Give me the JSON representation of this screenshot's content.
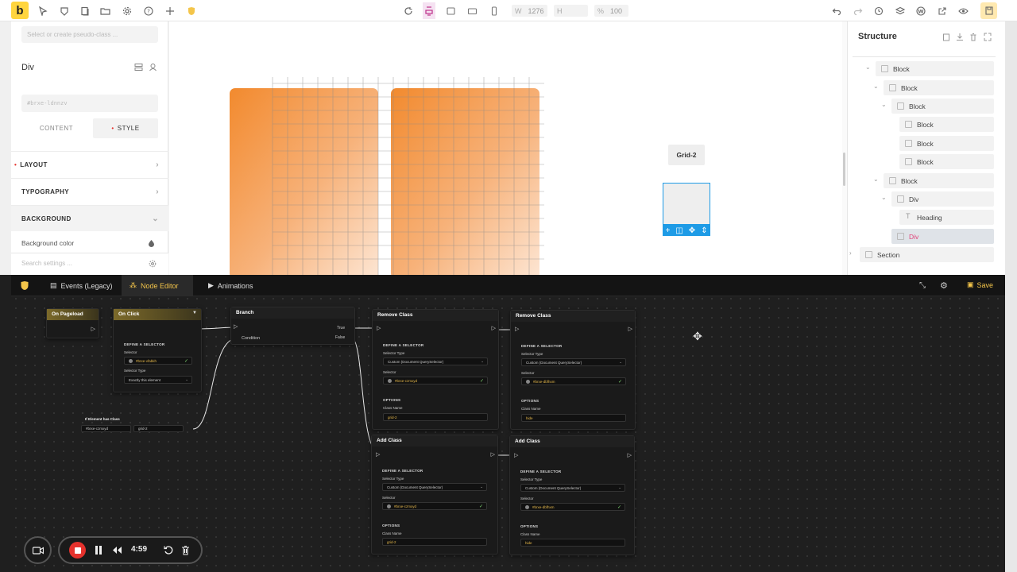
{
  "topbar": {
    "logo_letter": "b",
    "width_label": "W",
    "width_value": "1276",
    "height_label": "H",
    "height_value": "",
    "zoom_label": "%",
    "zoom_value": "100"
  },
  "left_panel": {
    "pseudo_placeholder": "Select or create pseudo-class ...",
    "element_title": "Div",
    "element_id": "#brxe-ldnnzv",
    "tabs": {
      "content": "CONTENT",
      "style": "STYLE"
    },
    "sections": [
      "LAYOUT",
      "TYPOGRAPHY",
      "BACKGROUND"
    ],
    "bg_color_label": "Background color",
    "search_placeholder": "Search settings ..."
  },
  "canvas": {
    "grid_label": "Grid-2"
  },
  "structure": {
    "title": "Structure",
    "items": [
      {
        "label": "Block"
      },
      {
        "label": "Block"
      },
      {
        "label": "Block"
      },
      {
        "label": "Block"
      },
      {
        "label": "Block"
      },
      {
        "label": "Block"
      },
      {
        "label": "Block"
      },
      {
        "label": "Div"
      },
      {
        "label": "Heading"
      },
      {
        "label": "Div"
      },
      {
        "label": "Section"
      }
    ]
  },
  "editor": {
    "tabs": [
      {
        "label": "Events (Legacy)"
      },
      {
        "label": "Node Editor"
      },
      {
        "label": "Animations"
      }
    ],
    "save_label": "Save",
    "nodes": {
      "on_pageload": {
        "title": "On Pageload"
      },
      "on_click": {
        "title": "On Click",
        "define": "DEFINE A SELECTOR",
        "selector_label": "Selector",
        "selector_value": "#brxe-vfabkh",
        "type_label": "Selector Type",
        "type_value": "Exactly this element"
      },
      "branch": {
        "title": "Branch",
        "condition": "Condition",
        "true_label": "True",
        "false_label": "False"
      },
      "if_class": {
        "title": "If Element has Class",
        "input1": "#brxe-czmxyd",
        "input2": "grid-2"
      },
      "remove1": {
        "title": "Remove Class",
        "define": "DEFINE A SELECTOR",
        "type_label": "Selector Type",
        "type_value": "Custom (Document QuerySelector)",
        "selector_label": "Selector",
        "selector_value": "#brxe-czmxyd",
        "options": "OPTIONS",
        "class_label": "Class Name",
        "class_value": "grid-2"
      },
      "remove2": {
        "title": "Remove Class",
        "define": "DEFINE A SELECTOR",
        "type_label": "Selector Type",
        "type_value": "Custom (Document QuerySelector)",
        "selector_label": "Selector",
        "selector_value": "#brxe-dbfhxm",
        "options": "OPTIONS",
        "class_label": "Class Name",
        "class_value": "hide"
      },
      "add1": {
        "title": "Add Class",
        "define": "DEFINE A SELECTOR",
        "type_label": "Selector Type",
        "type_value": "Custom (Document QuerySelector)",
        "selector_label": "Selector",
        "selector_value": "#brxe-czmxyd",
        "options": "OPTIONS",
        "class_label": "Class Name",
        "class_value": "grid-2"
      },
      "add2": {
        "title": "Add Class",
        "define": "DEFINE A SELECTOR",
        "type_label": "Selector Type",
        "type_value": "Custom (Document QuerySelector)",
        "selector_label": "Selector",
        "selector_value": "#brxe-dbfhxm",
        "options": "OPTIONS",
        "class_label": "Class Name",
        "class_value": "hide"
      }
    }
  },
  "recorder": {
    "time": "4:59"
  },
  "colors": {
    "accent": "#ffd53e",
    "orange": "#f28a2e",
    "select_blue": "#1e9be6",
    "record_red": "#e5322d"
  }
}
